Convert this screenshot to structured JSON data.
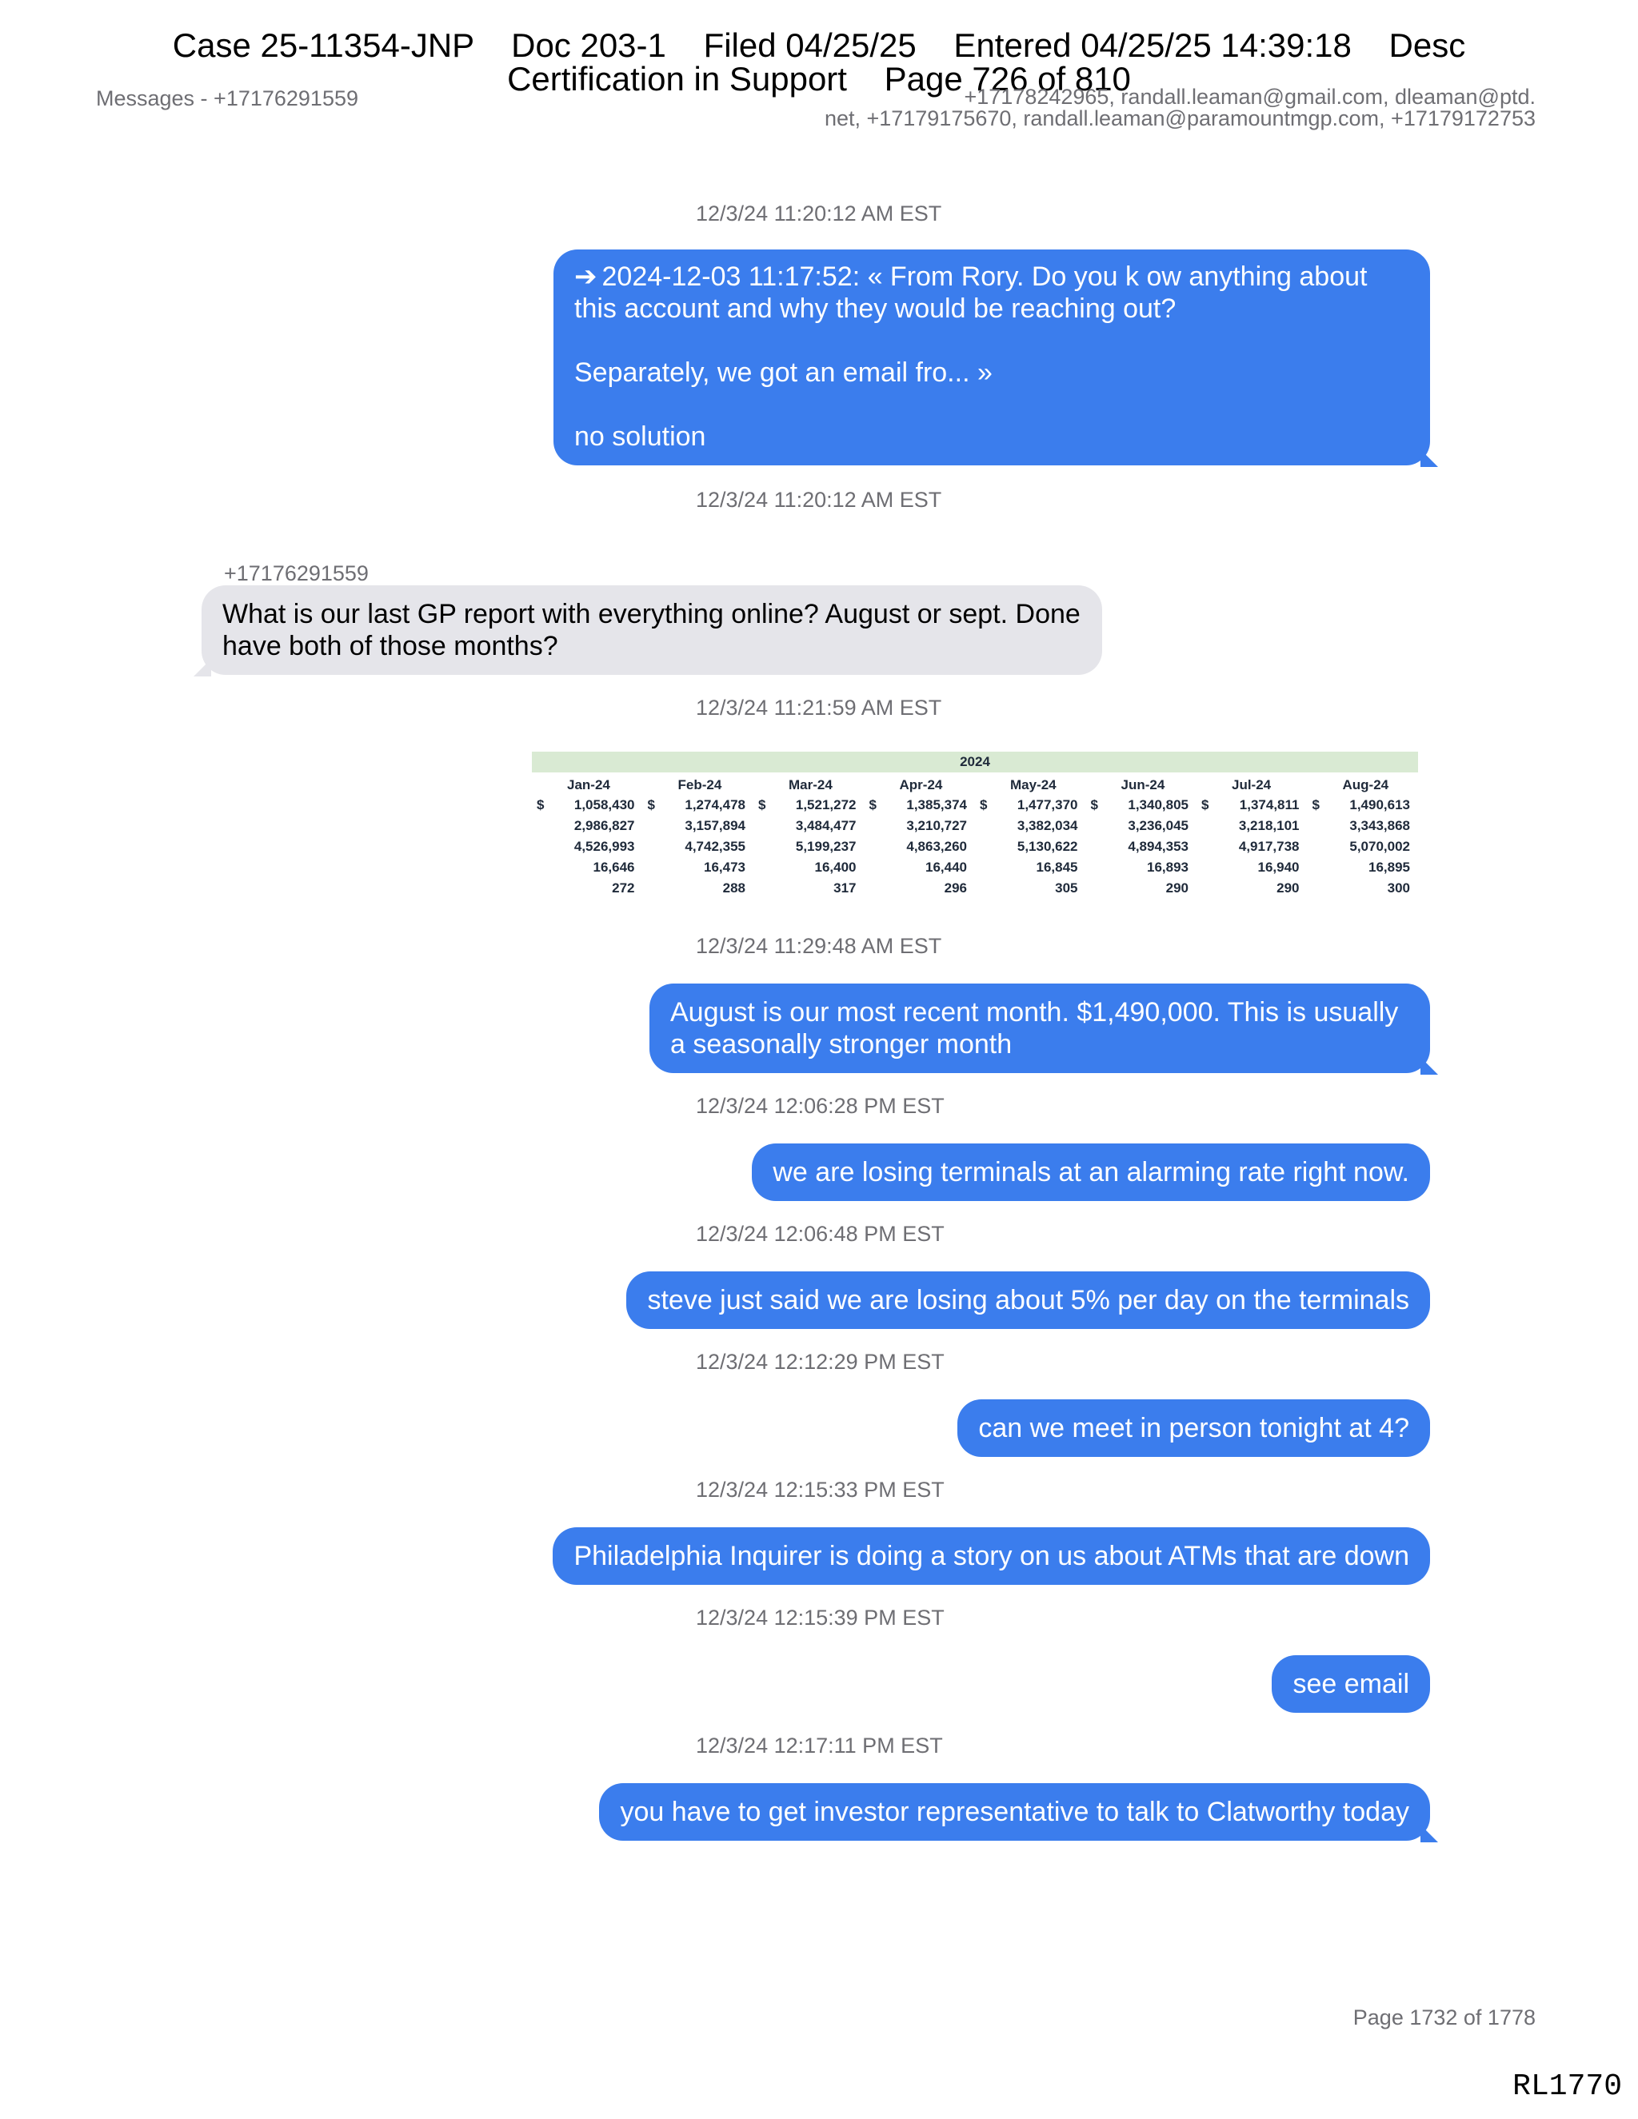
{
  "case_header": {
    "line1": "Case 25-11354-JNP    Doc 203-1    Filed 04/25/25    Entered 04/25/25 14:39:18    Desc",
    "line2": "Certification in Support    Page 726 of 810"
  },
  "messages_header": {
    "left": "Messages - +17176291559",
    "right_line1": "+17178242965, randall.leaman@gmail.com, dleaman@ptd.",
    "right_line2": "net, +17179175670, randall.leaman@paramountmgp.com, +17179172753"
  },
  "timestamps": [
    "12/3/24 11:20:12 AM EST",
    "12/3/24 11:20:12 AM EST",
    "12/3/24 11:21:59 AM EST",
    "12/3/24 11:29:48 AM EST",
    "12/3/24 12:06:28 PM EST",
    "12/3/24 12:06:48 PM EST",
    "12/3/24 12:12:29 PM EST",
    "12/3/24 12:15:33 PM EST",
    "12/3/24 12:15:39 PM EST",
    "12/3/24 12:17:11 PM EST"
  ],
  "forwarded": {
    "icon": "arrow-right-icon",
    "p1": "2024-12-03 11:17:52: « From Rory. Do you k ow anything about this account and why they would be reaching out?",
    "p2": "Separately, we got an email fro... »",
    "p3": "no solution"
  },
  "incoming": {
    "sender": "+17176291559",
    "text": "What is our last GP report with everything online?  August or sept.  Done have both of those months?"
  },
  "sheet": {
    "year": "2024",
    "dollar": "$",
    "columns": [
      {
        "month": "Jan-24",
        "values": [
          "1,058,430",
          "2,986,827",
          "4,526,993",
          "16,646",
          "272"
        ]
      },
      {
        "month": "Feb-24",
        "values": [
          "1,274,478",
          "3,157,894",
          "4,742,355",
          "16,473",
          "288"
        ]
      },
      {
        "month": "Mar-24",
        "values": [
          "1,521,272",
          "3,484,477",
          "5,199,237",
          "16,400",
          "317"
        ]
      },
      {
        "month": "Apr-24",
        "values": [
          "1,385,374",
          "3,210,727",
          "4,863,260",
          "16,440",
          "296"
        ]
      },
      {
        "month": "May-24",
        "values": [
          "1,477,370",
          "3,382,034",
          "5,130,622",
          "16,845",
          "305"
        ]
      },
      {
        "month": "Jun-24",
        "values": [
          "1,340,805",
          "3,236,045",
          "4,894,353",
          "16,893",
          "290"
        ]
      },
      {
        "month": "Jul-24",
        "values": [
          "1,374,811",
          "3,218,101",
          "4,917,738",
          "16,940",
          "290"
        ]
      },
      {
        "month": "Aug-24",
        "values": [
          "1,490,613",
          "3,343,868",
          "5,070,002",
          "16,895",
          "300"
        ]
      }
    ]
  },
  "outgoing": [
    "August is our most recent month. $1,490,000. This is usually a seasonally stronger month",
    "we are losing terminals at an alarming rate right now.",
    "steve just said we are losing about 5% per day on the terminals",
    "can we meet in person tonight at 4?",
    "Philadelphia Inquirer is doing a story on us about ATMs that are down",
    "see email",
    "you have to get investor representative to talk to Clatworthy today"
  ],
  "footer": {
    "page": "Page 1732 of 1778",
    "bates": "RL1770"
  }
}
